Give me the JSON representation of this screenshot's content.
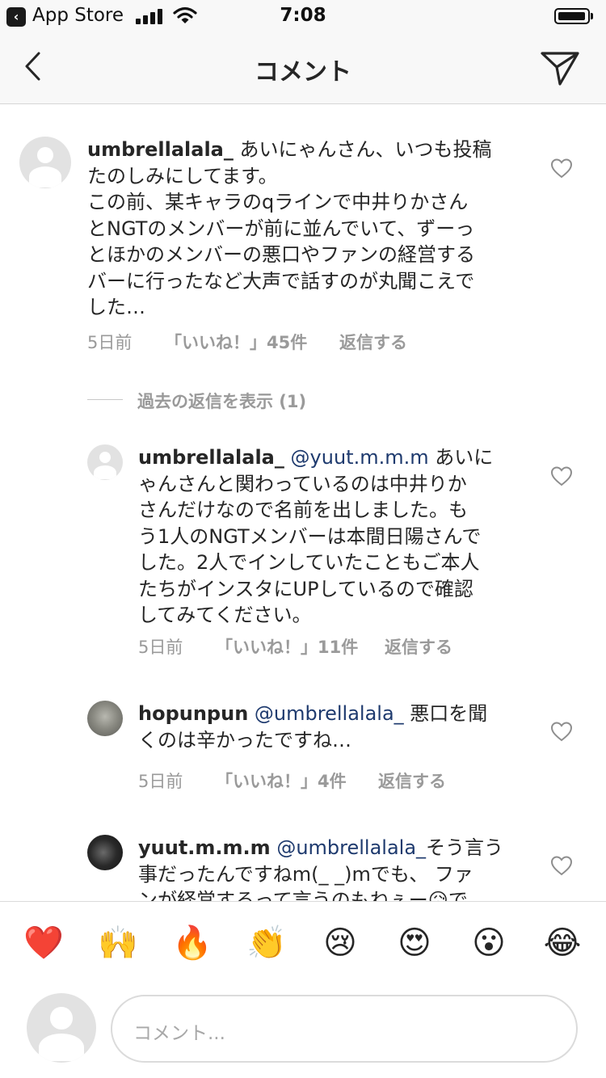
{
  "status_bar": {
    "back_app": "App Store",
    "time": "7:08"
  },
  "nav": {
    "title": "コメント"
  },
  "comments": [
    {
      "username": "umbrellalala_",
      "lines": [
        "あいにゃんさん、いつも投稿",
        "たのしみにしてます。",
        "この前、某キャラのqラインで中井りかさん",
        "とNGTのメンバーが前に並んでいて、ずーっ",
        "とほかのメンバーの悪口やファンの経営する",
        "バーに行ったなど大声で話すのが丸聞こえで",
        "した…"
      ],
      "time": "5日前",
      "likes": "「いいね！」45件",
      "reply": "返信する"
    },
    {
      "view_previous": "過去の返信を表示 (1)"
    },
    {
      "username": "umbrellalala_",
      "mention": "@yuut.m.m.m",
      "lines": [
        "あいに",
        "ゃんさんと関わっているのは中井りか",
        "さんだけなので名前を出しました。も",
        "う1人のNGTメンバーは本間日陽さんで",
        "した。2人でインしていたこともご本人",
        "たちがインスタにUPしているので確認",
        "してみてください。"
      ],
      "time": "5日前",
      "likes": "「いいね！」11件",
      "reply": "返信する"
    },
    {
      "username": "hopunpun",
      "mention": "@umbrellalala_",
      "lines": [
        "悪口を聞",
        "くのは辛かったですね…"
      ],
      "time": "5日前",
      "likes": "「いいね！」4件",
      "reply": "返信する"
    },
    {
      "username": "yuut.m.m.m",
      "mention": "@umbrellalala_",
      "lines": [
        "そう言う",
        "事だったんですねm(_ _)mでも、 ファ",
        "ンが経営するって言うのもねぇー😥で"
      ]
    }
  ],
  "emoji_bar": [
    "❤️",
    "🙌",
    "🔥",
    "👏",
    "😢",
    "😍",
    "😮",
    "😂"
  ],
  "input": {
    "placeholder": "コメント..."
  }
}
